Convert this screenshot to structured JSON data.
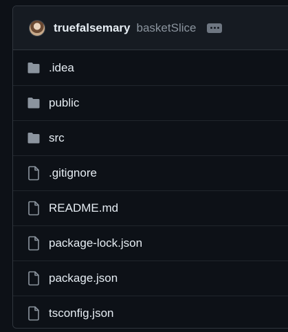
{
  "header": {
    "author": "truefalsemary",
    "commit_message": "basketSlice"
  },
  "files": [
    {
      "name": ".idea",
      "type": "folder"
    },
    {
      "name": "public",
      "type": "folder"
    },
    {
      "name": "src",
      "type": "folder"
    },
    {
      "name": ".gitignore",
      "type": "file"
    },
    {
      "name": "README.md",
      "type": "file"
    },
    {
      "name": "package-lock.json",
      "type": "file"
    },
    {
      "name": "package.json",
      "type": "file"
    },
    {
      "name": "tsconfig.json",
      "type": "file"
    }
  ],
  "icons": {
    "folder": "folder-icon",
    "file": "file-icon",
    "more": "kebab-horizontal-icon"
  },
  "colors": {
    "background": "#0d1117",
    "header_background": "#161b22",
    "border": "#30363d",
    "text": "#e6edf3",
    "muted_text": "#8b949e",
    "icon": "#8b949e"
  }
}
